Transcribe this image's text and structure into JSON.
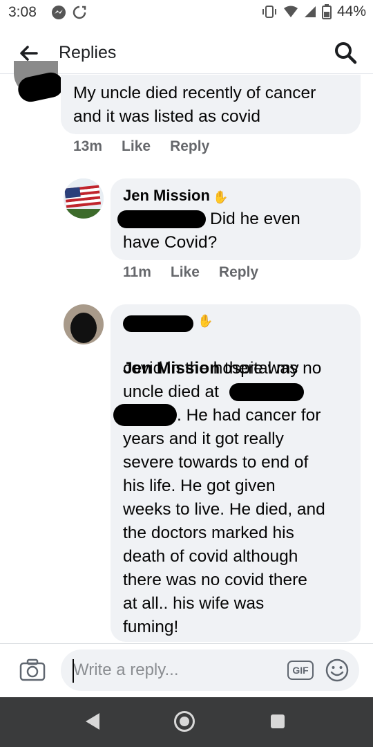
{
  "status": {
    "time": "3:08",
    "battery": "44%"
  },
  "header": {
    "title": "Replies"
  },
  "comments": [
    {
      "text": "My uncle died recently of cancer\nand it was listed as covid",
      "time": "13m",
      "like": "Like",
      "reply": "Reply"
    },
    {
      "author": "Jen Mission",
      "text_line1": "Did he even",
      "text_line2": "have Covid?",
      "time": "11m",
      "like": "Like",
      "reply": "Reply"
    },
    {
      "mention": "Jen Mission",
      "text_part1": " there was no",
      "text_line2": "covid in the hospital my",
      "text_line3": "uncle died at",
      "text_line4": ". He had cancer for",
      "text_rest": "years and it got really\nsevere towards to end of\nhis life. He got given\nweeks to live. He died, and\nthe doctors marked his\ndeath of covid although\nthere was no covid there\nat all.. his wife was\nfuming!"
    }
  ],
  "composer": {
    "placeholder": "Write a reply...",
    "gif_label": "GIF"
  },
  "icons": {
    "back": "arrow-left-icon",
    "search": "search-icon",
    "camera": "camera-icon",
    "emoji": "smiley-icon",
    "wave": "wave-hand-icon"
  },
  "colors": {
    "bubble": "#f0f2f5",
    "meta_text": "#65676b",
    "nav_bar": "#3a3b3c"
  }
}
